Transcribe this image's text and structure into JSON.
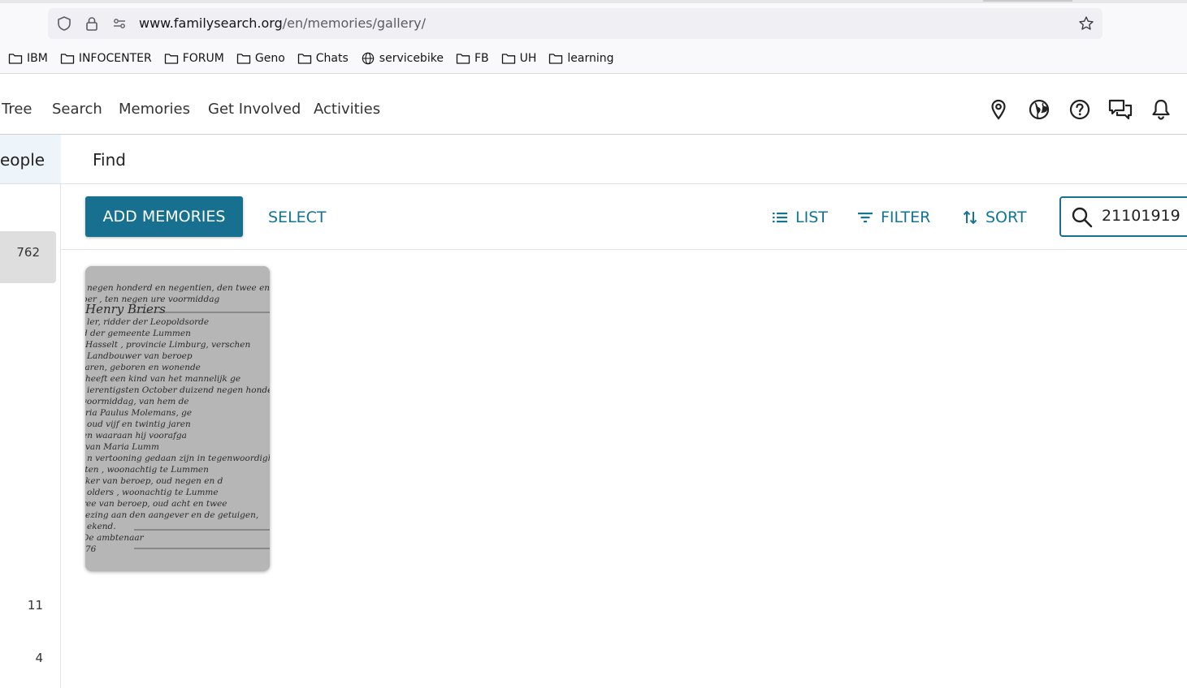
{
  "browser": {
    "url_host": "www.familysearch.org",
    "url_path": "/en/memories/gallery/",
    "bookmarks": [
      {
        "label": "IBM",
        "icon": "folder-icon"
      },
      {
        "label": "INFOCENTER",
        "icon": "folder-icon"
      },
      {
        "label": "FORUM",
        "icon": "folder-icon"
      },
      {
        "label": "Geno",
        "icon": "folder-icon"
      },
      {
        "label": "Chats",
        "icon": "folder-icon"
      },
      {
        "label": "servicebike",
        "icon": "globe-icon"
      },
      {
        "label": "FB",
        "icon": "folder-icon"
      },
      {
        "label": "UH",
        "icon": "folder-icon"
      },
      {
        "label": "learning",
        "icon": "folder-icon"
      }
    ]
  },
  "nav": {
    "items": [
      "Tree",
      "Search",
      "Memories",
      "Get Involved",
      "Activities"
    ],
    "icons": [
      "map-pin-icon",
      "globe-icon",
      "help-icon",
      "chat-icon",
      "bell-icon"
    ]
  },
  "subnav": {
    "people": "eople",
    "find": "Find"
  },
  "sidebar": {
    "counts": [
      "762",
      "11",
      "4"
    ]
  },
  "toolbar": {
    "add_label": "ADD MEMORIES",
    "select_label": "SELECT",
    "list_label": "LIST",
    "filter_label": "FILTER",
    "sort_label": "SORT",
    "search_value": "21101919"
  },
  "gallery": {
    "items": [
      {
        "type": "document-image",
        "lines": [
          "negen honderd en negentien, den twee en tw",
          "ber , ten negen ure voormiddag",
          "Henry Briers",
          "ler, ridder der Leopoldsorde",
          "d der gemeente Lummen",
          "Hasselt , provincie Limburg, verschen",
          "Landbouwer van beroep",
          "laren, geboren en wonende",
          "heeft een kind van het mannelijk ge",
          "ierentigsten October duizend negen honder",
          "voormiddag, van hem de",
          "ria Paulus Molemans, ge",
          "oud vijf en twintig jaren",
          "en waaraan hij voorafga",
          "van Maria Lumm",
          "n vertooning gedaan zijn in tegenwoordigheid",
          "lten , woonachtig te Lummen",
          "ker van beroep, oud negen en d",
          "olders , woonachtig te Lumme",
          "ree van beroep, oud acht en twee",
          "ezing aan den aangever en de getuigen,",
          "ekend.",
          "De ambtenaar",
          "76"
        ]
      }
    ]
  }
}
